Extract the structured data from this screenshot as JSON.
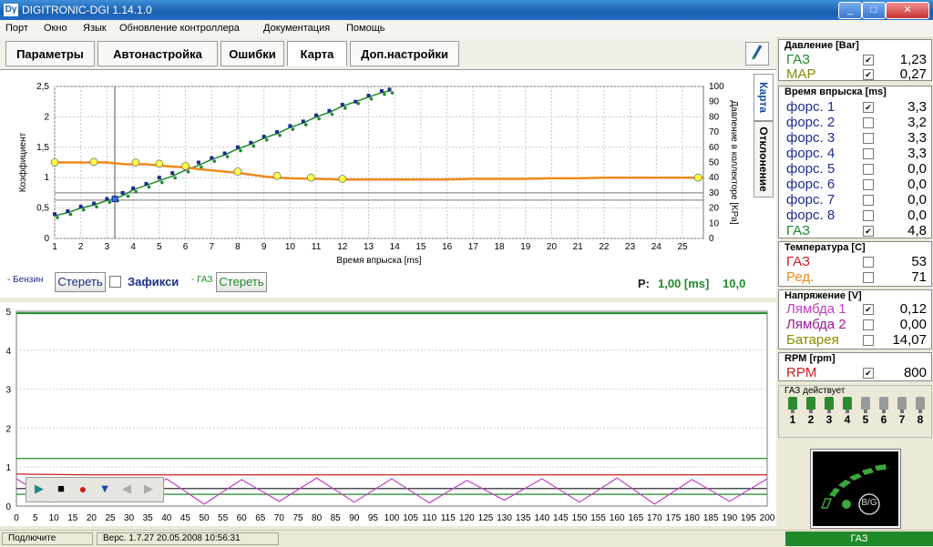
{
  "window": {
    "icon_text": "Dγ",
    "title": "DIGITRONIC-DGI    1.14.1.0",
    "btn_minimize": "_",
    "btn_restore": "□",
    "btn_close": "✕"
  },
  "menu": [
    "Порт",
    "Окно",
    "Язык",
    "Обновление контроллера",
    "Документация",
    "Помощь"
  ],
  "tabs": [
    "Параметры",
    "Автонастройка",
    "Ошибки",
    "Карта",
    "Доп.настройки"
  ],
  "active_tab": "Карта",
  "side_tabs": {
    "map": "Карта",
    "deviation": "Отклонение"
  },
  "map_controls": {
    "benzin_label": "- Бензин",
    "clear1": "Стереть",
    "fix_label": "Зафикси",
    "gas_label": "- ГАЗ",
    "clear2": "Стереть",
    "p_label": "P:",
    "p_value": "1,00 [ms]",
    "p_value2": "10,0"
  },
  "colors": {
    "gas_green": "#1e8a2a",
    "orange": "#ee8a1c",
    "navy": "#1b2d8c",
    "magenta": "#c23ec2",
    "red": "#c82020",
    "olive": "#8a8a00"
  },
  "chart_data": [
    {
      "type": "scatter",
      "xlabel": "Время впрыска [ms]",
      "ylabel": "Коэффициент",
      "y2label": "Давление в коллекторе [KPa]",
      "xlim": [
        1,
        25.8
      ],
      "ylim": [
        0,
        2.5
      ],
      "y2lim": [
        0,
        100
      ],
      "xticks": [
        1,
        2,
        3,
        4,
        5,
        6,
        7,
        8,
        9,
        10,
        11,
        12,
        13,
        14,
        15,
        16,
        17,
        18,
        19,
        20,
        21,
        22,
        23,
        24,
        25
      ],
      "yticks": [
        "0",
        "0,5",
        "1",
        "1,5",
        "2",
        "2,5"
      ],
      "y2ticks": [
        0,
        10,
        20,
        30,
        40,
        50,
        60,
        70,
        80,
        90,
        100
      ],
      "grid": true,
      "cursor_x": 3.3,
      "coef_curve": {
        "x": [
          1,
          2,
          3,
          3.7,
          4.5,
          5,
          5.5,
          6,
          6.5,
          7,
          7.5,
          8,
          9,
          9.5,
          10,
          11,
          12,
          13,
          14,
          15,
          16,
          17,
          18,
          19,
          20,
          21,
          22,
          22.5,
          23,
          24,
          25,
          25.8
        ],
        "y": [
          1.25,
          1.25,
          1.25,
          1.22,
          1.22,
          1.2,
          1.18,
          1.17,
          1.14,
          1.12,
          1.1,
          1.08,
          1.02,
          1.0,
          0.99,
          0.98,
          0.97,
          0.97,
          0.97,
          0.97,
          0.97,
          0.98,
          0.98,
          0.98,
          0.99,
          0.99,
          1.0,
          1.0,
          1.0,
          1.0,
          1.0,
          1.0
        ]
      },
      "coef_markers": {
        "x": [
          1,
          2.5,
          4.1,
          5,
          6,
          8,
          9.5,
          10.8,
          12,
          25.6
        ],
        "y": [
          1.25,
          1.26,
          1.25,
          1.23,
          1.19,
          1.1,
          1.03,
          1.0,
          0.98,
          1.0
        ]
      },
      "gas_points": {
        "x": [
          1,
          1.5,
          2,
          2.5,
          3,
          3.3,
          3.7,
          4,
          4.5,
          5,
          5.5,
          6,
          6.5,
          7,
          7.5,
          8,
          8.5,
          9,
          9.5,
          10,
          10.5,
          11,
          11.5,
          12,
          12.5,
          13,
          13.5,
          13.8
        ],
        "y": [
          15,
          17,
          20,
          22,
          25,
          26,
          29,
          32,
          35,
          38,
          41,
          45,
          48,
          52,
          55,
          59,
          62,
          66,
          69,
          73,
          76,
          80,
          83,
          87,
          90,
          93,
          96,
          97
        ]
      },
      "benzin_points": {
        "x": [
          1,
          1.5,
          2,
          2.5,
          3,
          3.3,
          3.6,
          4,
          4.5,
          5,
          5.5,
          6,
          6.5,
          7,
          7.5,
          8,
          8.5,
          9,
          9.5,
          10,
          10.5,
          11,
          11.5,
          12,
          12.5,
          13,
          13.5,
          13.8
        ],
        "y": [
          16,
          18,
          21,
          23,
          26,
          27,
          30,
          33,
          36,
          40,
          43,
          46,
          50,
          53,
          56,
          60,
          63,
          67,
          70,
          74,
          77,
          81,
          84,
          88,
          90,
          94,
          97,
          98
        ]
      }
    },
    {
      "type": "line",
      "xticks": [
        0,
        5,
        10,
        15,
        20,
        25,
        30,
        35,
        40,
        45,
        50,
        55,
        60,
        65,
        70,
        75,
        80,
        85,
        90,
        95,
        100,
        105,
        110,
        115,
        120,
        125,
        130,
        135,
        140,
        145,
        150,
        155,
        160,
        165,
        170,
        175,
        180,
        185,
        190,
        195,
        200
      ],
      "yticks": [
        0,
        1,
        2,
        3,
        4,
        5
      ],
      "xlim": [
        0,
        200
      ],
      "ylim": [
        0,
        5
      ],
      "series": [
        {
          "color": "#1e8a2a",
          "values": [
            4.95,
            4.95,
            4.95,
            4.95,
            4.95,
            4.95,
            4.95,
            4.95,
            4.95,
            4.95,
            4.95
          ]
        },
        {
          "color": "#1e8a2a",
          "values": [
            1.22,
            1.22,
            1.22,
            1.22,
            1.22,
            1.22,
            1.22,
            1.22,
            1.22,
            1.22,
            1.22
          ]
        },
        {
          "color": "#c82020",
          "values": [
            0.82,
            0.8,
            0.8,
            0.8,
            0.8,
            0.8,
            0.8,
            0.8,
            0.8,
            0.8,
            0.8
          ]
        },
        {
          "color": "#333333",
          "values": [
            0.45,
            0.45,
            0.45,
            0.45,
            0.45,
            0.45,
            0.45,
            0.45,
            0.45,
            0.45,
            0.45
          ]
        },
        {
          "color": "#1e8a2a",
          "values": [
            0.3,
            0.3,
            0.3,
            0.3,
            0.3,
            0.3,
            0.3,
            0.3,
            0.3,
            0.3,
            0.3
          ]
        },
        {
          "color": "#c23ec2",
          "values": [
            0.7,
            0.1,
            0.65,
            0.15,
            0.7,
            0.05,
            0.68,
            0.12,
            0.72,
            0.1,
            0.7,
            0.08,
            0.66,
            0.15,
            0.7,
            0.1,
            0.72,
            0.05,
            0.68,
            0.12,
            0.7
          ]
        }
      ]
    }
  ],
  "playback": [
    "▶",
    "■",
    "●",
    "▼",
    "◀",
    "▶"
  ],
  "right_panel": {
    "pressure": {
      "title": "Давление [Bar]",
      "rows": [
        {
          "label": "ГАЗ",
          "checked": true,
          "value": "1,23",
          "color": "#1e8a2a"
        },
        {
          "label": "MAP",
          "checked": true,
          "value": "0,27",
          "color": "#8a8a00"
        }
      ]
    },
    "injection": {
      "title": "Время впрыска [ms]",
      "rows": [
        {
          "label": "форс. 1",
          "checked": true,
          "value": "3,3",
          "color": "#1b2d8c"
        },
        {
          "label": "форс. 2",
          "checked": false,
          "value": "3,2",
          "color": "#1b2d8c"
        },
        {
          "label": "форс. 3",
          "checked": false,
          "value": "3,3",
          "color": "#1b2d8c"
        },
        {
          "label": "форс. 4",
          "checked": false,
          "value": "3,3",
          "color": "#1b2d8c"
        },
        {
          "label": "форс. 5",
          "checked": false,
          "value": "0,0",
          "color": "#1b2d8c"
        },
        {
          "label": "форс. 6",
          "checked": false,
          "value": "0,0",
          "color": "#1b2d8c"
        },
        {
          "label": "форс. 7",
          "checked": false,
          "value": "0,0",
          "color": "#1b2d8c"
        },
        {
          "label": "форс. 8",
          "checked": false,
          "value": "0,0",
          "color": "#1b2d8c"
        },
        {
          "label": "ГАЗ",
          "checked": true,
          "value": "4,8",
          "color": "#1e8a2a"
        }
      ]
    },
    "temperature": {
      "title": "Температура [C]",
      "rows": [
        {
          "label": "ГАЗ",
          "checked": false,
          "value": "53",
          "color": "#c82020"
        },
        {
          "label": "Ред.",
          "checked": false,
          "value": "71",
          "color": "#ee8a1c"
        }
      ]
    },
    "voltage": {
      "title": "Напряжение [V]",
      "rows": [
        {
          "label": "Лямбда 1",
          "checked": true,
          "value": "0,12",
          "color": "#c23ec2"
        },
        {
          "label": "Лямбда 2",
          "checked": false,
          "value": "0,00",
          "color": "#9a1a9a"
        },
        {
          "label": "Батарея",
          "checked": false,
          "value": "14,07",
          "color": "#8a8a00"
        }
      ]
    },
    "rpm": {
      "title": "RPM [rpm]",
      "rows": [
        {
          "label": "RPM",
          "checked": true,
          "value": "800",
          "color": "#c82020"
        }
      ]
    },
    "gas_active": {
      "title": "ГАЗ действует",
      "injectors": [
        {
          "n": "1",
          "active": true
        },
        {
          "n": "2",
          "active": true
        },
        {
          "n": "3",
          "active": true
        },
        {
          "n": "4",
          "active": true
        },
        {
          "n": "5",
          "active": false
        },
        {
          "n": "6",
          "active": false
        },
        {
          "n": "7",
          "active": false
        },
        {
          "n": "8",
          "active": false
        }
      ]
    },
    "switch_label": "B/G",
    "status_mode": "ГАЗ"
  },
  "status": {
    "connect": "Подлючите",
    "version": "Верс. 1.7.27   20.05.2008   10:56:31"
  }
}
